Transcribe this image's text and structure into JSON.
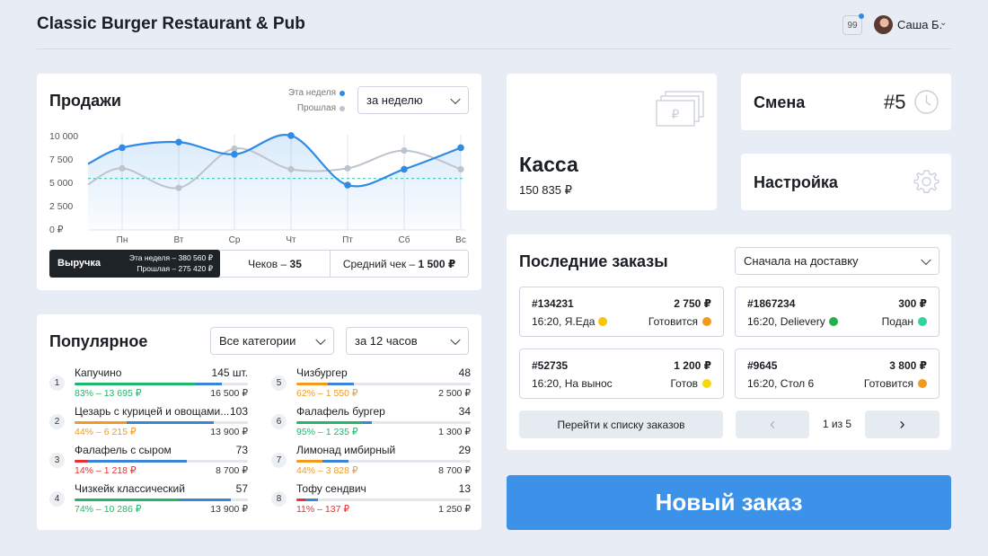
{
  "header": {
    "title": "Classic Burger Restaurant & Pub",
    "notifications": "99",
    "user": "Саша Б."
  },
  "sales": {
    "title": "Продажи",
    "legend_this": "Эта неделя",
    "legend_prev": "Прошлая",
    "period": "за неделю",
    "revenue_label": "Выручка",
    "revenue_this": "Эта неделя – 380 560 ₽",
    "revenue_prev": "Прошлая – 275 420 ₽",
    "checks_label": "Чеков – ",
    "checks_value": "35",
    "avg_label": "Средний чек – ",
    "avg_value": "1 500 ₽"
  },
  "chart_data": {
    "type": "line",
    "categories": [
      "Пн",
      "Вт",
      "Ср",
      "Чт",
      "Пт",
      "Сб",
      "Вс"
    ],
    "y_ticks": [
      "10 000",
      "7 500",
      "5 000",
      "2 500",
      "0 ₽"
    ],
    "ylim": [
      0,
      10000
    ],
    "series": [
      {
        "name": "Эта неделя",
        "color": "#2f8be6",
        "values": [
          8800,
          9400,
          8100,
          10100,
          4800,
          6500,
          8800
        ]
      },
      {
        "name": "Прошлая",
        "color": "#bcc4ce",
        "values": [
          6600,
          4500,
          8700,
          6500,
          6600,
          8500,
          6500
        ]
      }
    ],
    "average_line": 5500,
    "legend": "top-right"
  },
  "kassa": {
    "title": "Касса",
    "amount": "150 835 ₽"
  },
  "shift": {
    "title": "Смена",
    "number": "#5"
  },
  "settings": {
    "title": "Настройка"
  },
  "popular": {
    "title": "Популярное",
    "category_filter": "Все категории",
    "time_filter": "за 12 часов",
    "items": [
      {
        "rank": "1",
        "name": "Капучино",
        "count": "145 шт.",
        "pct": "83% – 13 695 ₽",
        "sum": "16 500 ₽",
        "pct_color": "#1fb86b"
      },
      {
        "rank": "2",
        "name": "Цезарь с курицей и овощами...",
        "count": "103",
        "pct": "44% – 6 215 ₽",
        "sum": "13 900 ₽",
        "pct_color": "#f29a20"
      },
      {
        "rank": "3",
        "name": "Фалафель с сыром",
        "count": "73",
        "pct": "14% – 1 218 ₽",
        "sum": "8 700 ₽",
        "pct_color": "#e8302e"
      },
      {
        "rank": "4",
        "name": "Чизкейк классический",
        "count": "57",
        "pct": "74% – 10 286 ₽",
        "sum": "13 900 ₽",
        "pct_color": "#1fb86b"
      },
      {
        "rank": "5",
        "name": "Чизбургер",
        "count": "48",
        "pct": "62% – 1 550 ₽",
        "sum": "2 500 ₽",
        "pct_color": "#f29a20"
      },
      {
        "rank": "6",
        "name": "Фалафель бургер",
        "count": "34",
        "pct": "95% – 1 235 ₽",
        "sum": "1 300 ₽",
        "pct_color": "#1fb86b"
      },
      {
        "rank": "7",
        "name": "Лимонад имбирный",
        "count": "29",
        "pct": "44% – 3 828 ₽",
        "sum": "8 700 ₽",
        "pct_color": "#f29a20"
      },
      {
        "rank": "8",
        "name": "Тофу сендвич",
        "count": "13",
        "pct": "11% – 137 ₽",
        "sum": "1 250 ₽",
        "pct_color": "#e8302e"
      }
    ],
    "bar_levels": [
      {
        "color_pct": 0.7,
        "blue_pct": 0.15
      },
      {
        "color_pct": 0.3,
        "blue_pct": 0.5
      },
      {
        "color_pct": 0.08,
        "blue_pct": 0.57
      },
      {
        "color_pct": 0.6,
        "blue_pct": 0.3
      },
      {
        "color_pct": 0.18,
        "blue_pct": 0.15
      },
      {
        "color_pct": 0.38,
        "blue_pct": 0.05
      },
      {
        "color_pct": 0.15,
        "blue_pct": 0.15
      },
      {
        "color_pct": 0.05,
        "blue_pct": 0.07
      }
    ]
  },
  "orders": {
    "title": "Последние заказы",
    "sort": "Сначала на доставку",
    "list": [
      {
        "num": "#134231",
        "amount": "2 750 ₽",
        "info": "16:20, Я.Еда",
        "status": "Готовится",
        "status_color": "#f29a20",
        "src_color": "#f7c600"
      },
      {
        "num": "#1867234",
        "amount": "300 ₽",
        "info": "16:20, Delievery",
        "status": "Подан",
        "status_color": "#34d399",
        "src_color": "#22b14c"
      },
      {
        "num": "#52735",
        "amount": "1 200 ₽",
        "info": "16:20, На вынос",
        "status": "Готов",
        "status_color": "#f5d90a",
        "src_color": ""
      },
      {
        "num": "#9645",
        "amount": "3 800 ₽",
        "info": "16:20, Стол 6",
        "status": "Готовится",
        "status_color": "#f29a20",
        "src_color": ""
      }
    ],
    "go_to_list": "Перейти к списку заказов",
    "page": "1 из 5"
  },
  "new_order": {
    "label": "Новый заказ"
  },
  "colors": {
    "accent": "#3b92e8",
    "green": "#1fb86b",
    "blue_bar": "#3b84d6"
  }
}
